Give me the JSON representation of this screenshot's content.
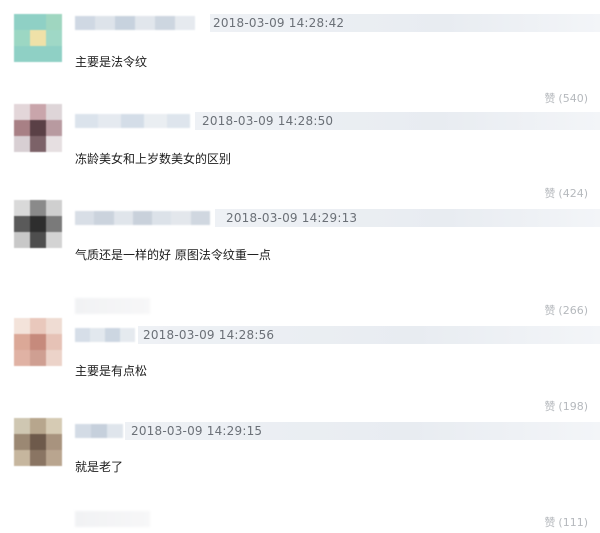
{
  "comments": [
    {
      "timestamp": "2018-03-09 14:28:42",
      "text": "主要是法令纹",
      "like_label": "赞",
      "like_count": "(540)",
      "avatar_colors": [
        "#8fd0c5",
        "#8fd0c5",
        "#9fd6c0",
        "#9cd7c3",
        "#efe1a8",
        "#9fd8c6",
        "#8fd0c5",
        "#8fd0c5",
        "#8fd0c5"
      ],
      "name_colors": [
        "#cfd8e3",
        "#dde3ea",
        "#c7d2de",
        "#e1e6ec",
        "#cdd6e0",
        "#e6eaef"
      ]
    },
    {
      "timestamp": "2018-03-09 14:28:50",
      "text": "冻龄美女和上岁数美女的区别",
      "like_label": "赞",
      "like_count": "(424)",
      "avatar_colors": [
        "#e3d6d9",
        "#c9a5ab",
        "#ded5d8",
        "#a88085",
        "#5a4046",
        "#b89aa0",
        "#d8cfd3",
        "#7c6268",
        "#e6dfe1"
      ],
      "name_colors": [
        "#dbe3ec",
        "#e5eaf0",
        "#d4dde8",
        "#eaeef2",
        "#dee5ed"
      ]
    },
    {
      "timestamp": "2018-03-09 14:29:13",
      "text": "气质还是一样的好 原图法令纹重一点",
      "like_label": "赞",
      "like_count": "(266)",
      "avatar_colors": [
        "#d9d9d9",
        "#8a8a8a",
        "#cfcfcf",
        "#5a5a5a",
        "#2e2e2e",
        "#7a7a7a",
        "#c8c8c8",
        "#4e4e4e",
        "#d3d3d3"
      ],
      "name_colors": [
        "#d8dee6",
        "#cbd3dd",
        "#e0e5eb",
        "#c9d1db",
        "#dce2e9",
        "#e3e7ec",
        "#d0d7e0"
      ]
    },
    {
      "timestamp": "2018-03-09 14:28:56",
      "text": "主要是有点松",
      "like_label": "赞",
      "like_count": "(198)",
      "avatar_colors": [
        "#f3e3da",
        "#e9c8bc",
        "#efdcd3",
        "#dba897",
        "#c68a7c",
        "#e6c2b6",
        "#e0b2a4",
        "#cf9f92",
        "#ecd3c9"
      ],
      "name_colors": [
        "#d6dee8",
        "#e2e8ee",
        "#ccd6e1",
        "#e5eaef"
      ]
    },
    {
      "timestamp": "2018-03-09 14:29:15",
      "text": "就是老了",
      "like_label": "赞",
      "like_count": "(111)",
      "avatar_colors": [
        "#cfc7b2",
        "#b7a68d",
        "#d6cbb4",
        "#9b8873",
        "#6e5a4b",
        "#a8937e",
        "#c6b69e",
        "#8a7563",
        "#b9a58f"
      ],
      "name_colors": [
        "#d3dbe5",
        "#c6d0dc",
        "#dfe5ec"
      ]
    }
  ]
}
